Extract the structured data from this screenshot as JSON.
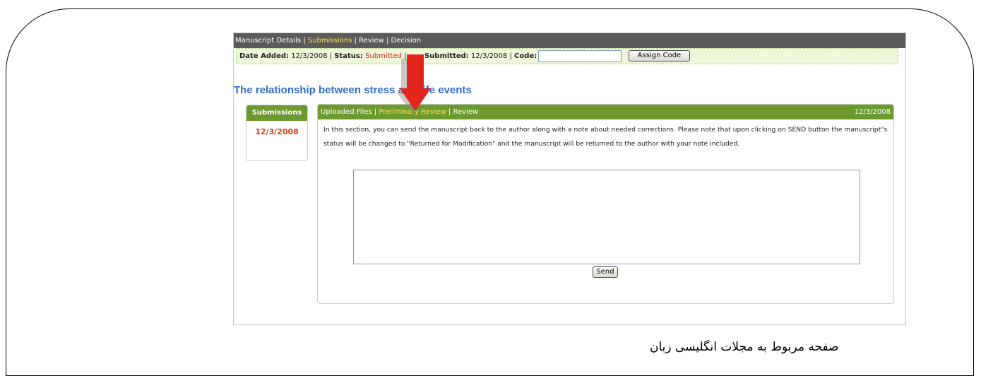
{
  "topnav": {
    "details": "Manuscript Details",
    "submissions": "Submissions",
    "review": "Review",
    "decision": "Decision"
  },
  "infobar": {
    "date_added_label": "Date Added:",
    "date_added_value": "12/3/2008",
    "status_label": "Status:",
    "status_value": "Submitted",
    "submitted_label": "Submitted:",
    "submitted_value": "12/3/2008",
    "code_label": "Code:",
    "code_value": "",
    "assign_label": "Assign Code"
  },
  "page_title": "The relationship between stress and life events",
  "sidebar": {
    "header": "Submissions",
    "date": "12/3/2008"
  },
  "panel": {
    "tab_uploaded": "Uploaded Files",
    "tab_preliminary": "Preliminary Review",
    "tab_review": "Review",
    "date": "12/3/2008",
    "description": "In this section, you can send the manuscript back to the author along with a note about needed corrections. Please note that upon clicking on SEND button the manuscript\"s status will be changed to \"Returned for Modification\" and the manuscript will be returned to the author with your note included.",
    "note_value": "",
    "send_label": "Send"
  },
  "caption": "صفحه مربوط به مجلات انگلیسی زبان",
  "colors": {
    "header_green": "#6c9a2f",
    "active_tab": "#ffe14d",
    "title_blue": "#2f6bcc",
    "status_red": "#d42b1e",
    "arrow_red": "#e3261c"
  },
  "icons": {
    "arrow": "down-arrow-icon"
  }
}
